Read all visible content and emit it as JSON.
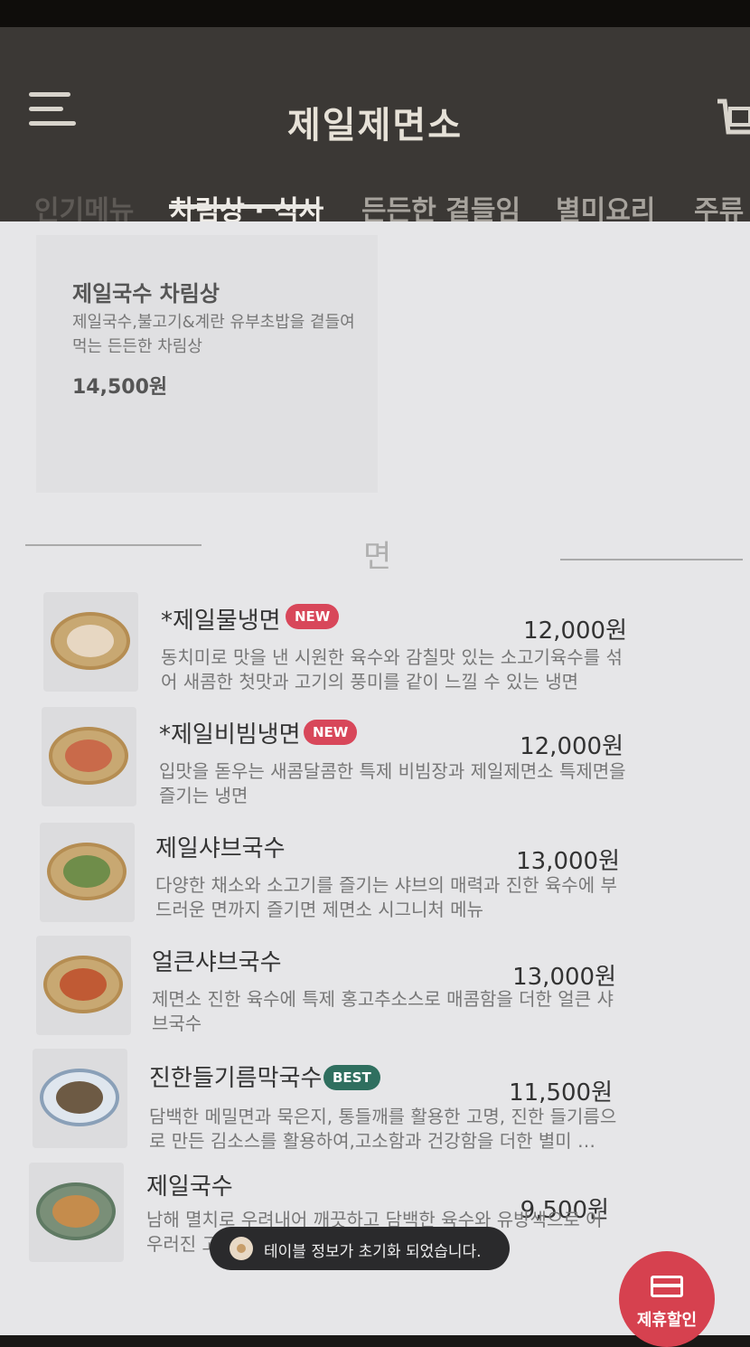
{
  "header": {
    "title": "제일제면소",
    "tabs": [
      {
        "label": "인기메뉴",
        "active": false
      },
      {
        "label": "차림상 · 식사",
        "active": true
      },
      {
        "label": "든든한 곁들임",
        "active": false
      },
      {
        "label": "별미요리",
        "active": false
      },
      {
        "label": "주류",
        "active": false
      }
    ]
  },
  "set_card": {
    "title": "제일국수 차림상",
    "description": "제일국수,불고기&계란 유부초밥을 곁들여 먹는 든든한 차림상",
    "price": "14,500원"
  },
  "section": {
    "title": "면"
  },
  "items": [
    {
      "name": "*제일물냉면",
      "badge": "NEW",
      "badge_type": "new",
      "price": "12,000원",
      "description": "동치미로 맛을 낸 시원한 육수와 감칠맛 있는 소고기육수를 섞어 새콤한 첫맛과 고기의 풍미를 같이 느낄 수 있는 냉면"
    },
    {
      "name": "*제일비빔냉면",
      "badge": "NEW",
      "badge_type": "new",
      "price": "12,000원",
      "description": "입맛을 돋우는 새콤달콤한 특제 비빔장과 제일제면소 특제면을 즐기는 냉면"
    },
    {
      "name": "제일샤브국수",
      "badge": "",
      "badge_type": "",
      "price": "13,000원",
      "description": "다양한 채소와 소고기를 즐기는 샤브의 매력과 진한 육수에 부드러운 면까지 즐기면 제면소 시그니처 메뉴"
    },
    {
      "name": "얼큰샤브국수",
      "badge": "",
      "badge_type": "",
      "price": "13,000원",
      "description": "제면소 진한 육수에 특제 홍고추소스로 매콤함을 더한 얼큰 샤브국수"
    },
    {
      "name": "진한들기름막국수",
      "badge": "BEST",
      "badge_type": "best",
      "price": "11,500원",
      "description": "담백한 메밀면과 묵은지, 통들깨를 활용한 고명, 진한 들기름으로 만든 김소스를 활용하여,고소함과 건강함을 더한 별미 …"
    },
    {
      "name": "제일국수",
      "badge": "",
      "badge_type": "",
      "price": "9,500원",
      "description": "남해 멸치로 우려내어 깨끗하고 담백한 육수와 유방색으로 어우러진 고명"
    }
  ],
  "toast": {
    "message": "테이블 정보가 초기화 되었습니다."
  },
  "discount_button": {
    "label": "제휴할인"
  },
  "colors": {
    "header_bg": "#3b3835",
    "badge_new": "#d8475a",
    "badge_best": "#2f6f5f",
    "discount": "#d6414f"
  }
}
